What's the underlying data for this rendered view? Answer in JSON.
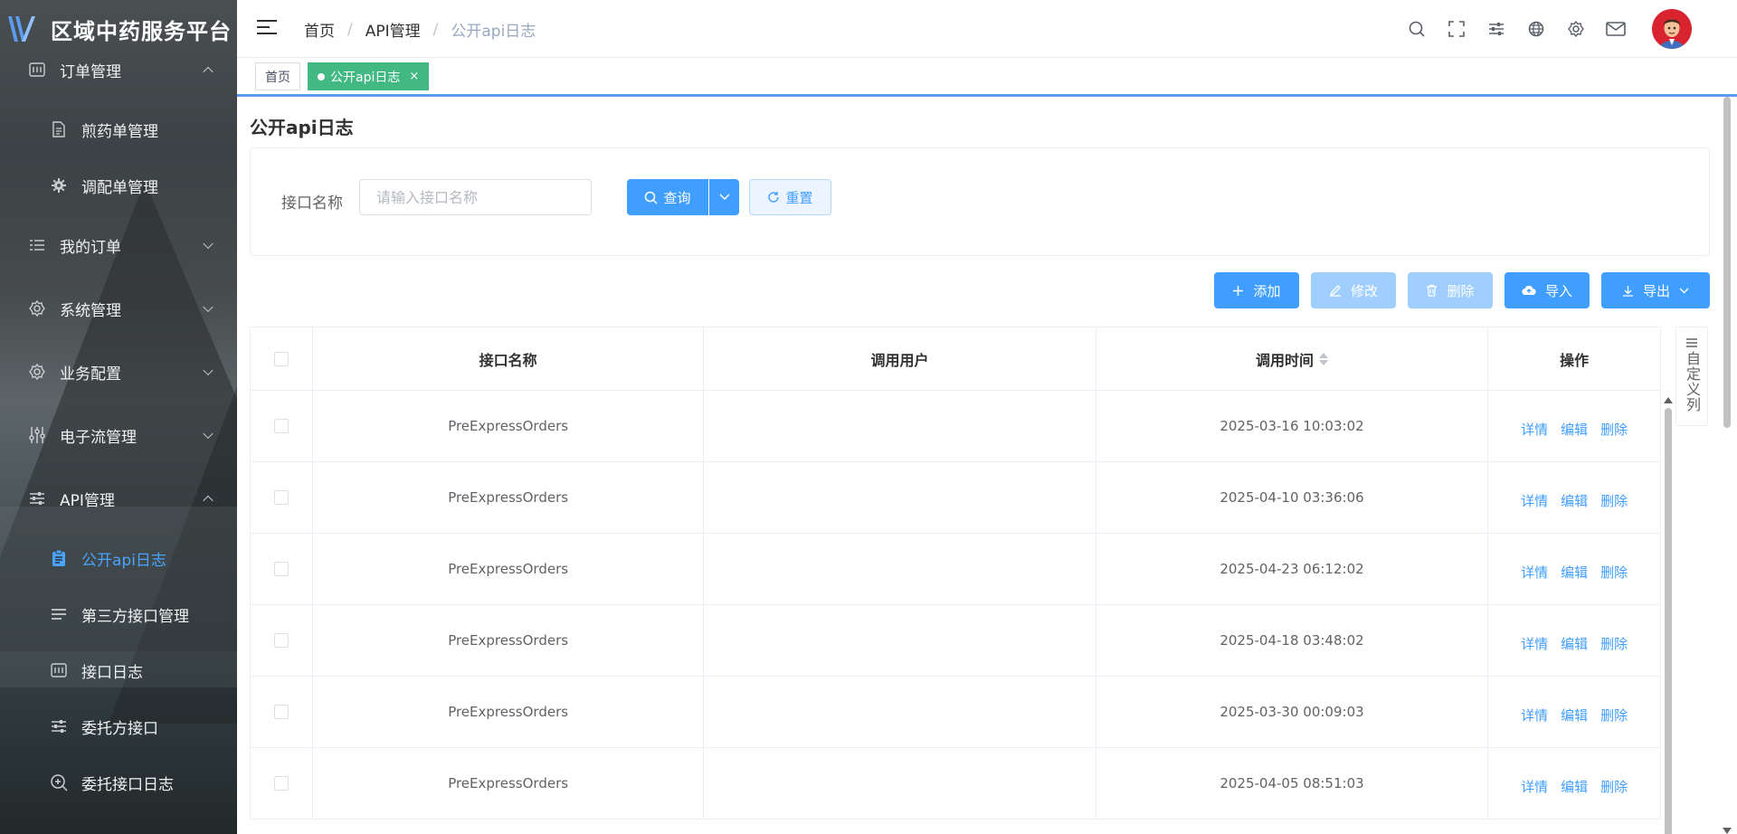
{
  "app": {
    "title": "区域中药服务平台"
  },
  "sidebar": {
    "items": [
      {
        "label": "订单管理",
        "icon": "order-icon",
        "level": "top",
        "expanded": true
      },
      {
        "label": "煎药单管理",
        "icon": "document-icon",
        "level": "sub"
      },
      {
        "label": "调配单管理",
        "icon": "gear-icon",
        "level": "sub"
      },
      {
        "label": "我的订单",
        "icon": "list-icon",
        "level": "top",
        "expanded": false
      },
      {
        "label": "系统管理",
        "icon": "settings-icon",
        "level": "top",
        "expanded": false
      },
      {
        "label": "业务配置",
        "icon": "settings-icon",
        "level": "top",
        "expanded": false
      },
      {
        "label": "电子流管理",
        "icon": "sliders-icon",
        "level": "top",
        "expanded": false
      },
      {
        "label": "API管理",
        "icon": "adjust-icon",
        "level": "top",
        "expanded": true
      },
      {
        "label": "公开api日志",
        "icon": "clipboard-icon",
        "level": "sub",
        "active": true
      },
      {
        "label": "第三方接口管理",
        "icon": "list-icon",
        "level": "sub"
      },
      {
        "label": "接口日志",
        "icon": "log-icon",
        "level": "sub"
      },
      {
        "label": "委托方接口",
        "icon": "adjust-icon",
        "level": "sub"
      },
      {
        "label": "委托接口日志",
        "icon": "zoom-icon",
        "level": "sub"
      }
    ]
  },
  "header": {
    "breadcrumb": [
      "首页",
      "API管理",
      "公开api日志"
    ],
    "breadcrumb_sep": "/",
    "icons": [
      "search-icon",
      "fullscreen-icon",
      "sliders-icon",
      "globe-icon",
      "gear-icon",
      "mail-icon"
    ]
  },
  "tags": {
    "home": "首页",
    "active": "公开api日志",
    "close": "×"
  },
  "page": {
    "title": "公开api日志"
  },
  "search": {
    "label": "接口名称",
    "placeholder": "请输入接口名称",
    "value": "",
    "query_label": "查询",
    "reset_label": "重置"
  },
  "toolbar": {
    "add": "添加",
    "edit": "修改",
    "delete": "删除",
    "import": "导入",
    "export": "导出"
  },
  "table": {
    "columns": [
      "接口名称",
      "调用用户",
      "调用时间",
      "操作"
    ],
    "rows": [
      {
        "name": "PreExpressOrders",
        "user": "",
        "time": "2025-03-16 10:03:02"
      },
      {
        "name": "PreExpressOrders",
        "user": "",
        "time": "2025-04-10 03:36:06"
      },
      {
        "name": "PreExpressOrders",
        "user": "",
        "time": "2025-04-23 06:12:02"
      },
      {
        "name": "PreExpressOrders",
        "user": "",
        "time": "2025-04-18 03:48:02"
      },
      {
        "name": "PreExpressOrders",
        "user": "",
        "time": "2025-03-30 00:09:03"
      },
      {
        "name": "PreExpressOrders",
        "user": "",
        "time": "2025-04-05 08:51:03"
      }
    ],
    "actions": [
      "详情",
      "编辑",
      "删除"
    ],
    "custom_columns": "自定义列"
  },
  "colors": {
    "primary": "#409eff",
    "primary_light": "#a0cfff",
    "tag_active": "#42b983",
    "sidebar_active": "#4aa3ff"
  }
}
